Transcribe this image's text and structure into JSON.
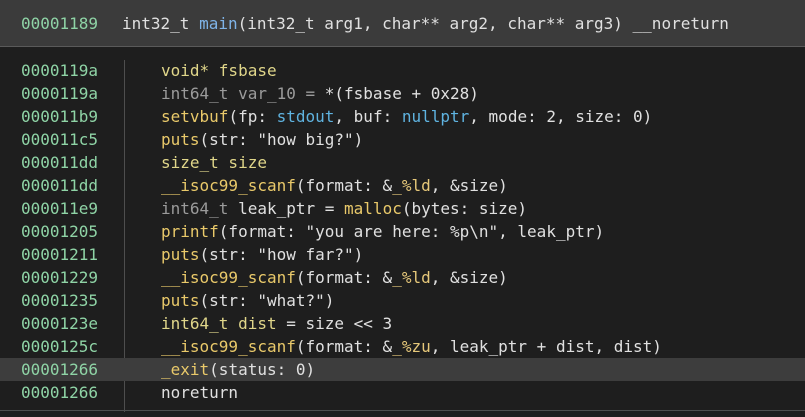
{
  "header": {
    "address": "00001189",
    "signature": [
      {
        "text": "int32_t ",
        "cls": "t-plain"
      },
      {
        "text": "main",
        "cls": "t-main"
      },
      {
        "text": "(int32_t arg1, char** arg2, char** arg3) __noreturn",
        "cls": "t-plain"
      }
    ]
  },
  "highlight_index": 13,
  "rows": [
    {
      "address": "0000119a",
      "tokens": [
        {
          "text": "void* fsbase",
          "cls": "t-type"
        }
      ]
    },
    {
      "address": "0000119a",
      "tokens": [
        {
          "text": "int64_t var_10 = ",
          "cls": "t-gray"
        },
        {
          "text": "*(fsbase + 0x28)",
          "cls": "t-plain"
        }
      ]
    },
    {
      "address": "000011b9",
      "tokens": [
        {
          "text": "setvbuf",
          "cls": "t-func"
        },
        {
          "text": "(fp: ",
          "cls": "t-plain"
        },
        {
          "text": "stdout",
          "cls": "t-kw"
        },
        {
          "text": ", buf: ",
          "cls": "t-plain"
        },
        {
          "text": "nullptr",
          "cls": "t-kw"
        },
        {
          "text": ", mode: 2, size: 0)",
          "cls": "t-plain"
        }
      ]
    },
    {
      "address": "000011c5",
      "tokens": [
        {
          "text": "puts",
          "cls": "t-func"
        },
        {
          "text": "(str: \"how big?\")",
          "cls": "t-plain"
        }
      ]
    },
    {
      "address": "000011dd",
      "tokens": [
        {
          "text": "size_t size",
          "cls": "t-type"
        }
      ]
    },
    {
      "address": "000011dd",
      "tokens": [
        {
          "text": "__isoc99_scanf",
          "cls": "t-func"
        },
        {
          "text": "(format: &",
          "cls": "t-plain"
        },
        {
          "text": "_%ld",
          "cls": "t-sym"
        },
        {
          "text": ", &size)",
          "cls": "t-plain"
        }
      ]
    },
    {
      "address": "000011e9",
      "tokens": [
        {
          "text": "int64_t ",
          "cls": "t-gray"
        },
        {
          "text": "leak_ptr = ",
          "cls": "t-plain"
        },
        {
          "text": "malloc",
          "cls": "t-func"
        },
        {
          "text": "(bytes: size)",
          "cls": "t-plain"
        }
      ]
    },
    {
      "address": "00001205",
      "tokens": [
        {
          "text": "printf",
          "cls": "t-func"
        },
        {
          "text": "(format: \"you are here: %p\\n\", leak_ptr)",
          "cls": "t-plain"
        }
      ]
    },
    {
      "address": "00001211",
      "tokens": [
        {
          "text": "puts",
          "cls": "t-func"
        },
        {
          "text": "(str: \"how far?\")",
          "cls": "t-plain"
        }
      ]
    },
    {
      "address": "00001229",
      "tokens": [
        {
          "text": "__isoc99_scanf",
          "cls": "t-func"
        },
        {
          "text": "(format: &",
          "cls": "t-plain"
        },
        {
          "text": "_%ld",
          "cls": "t-sym"
        },
        {
          "text": ", &size)",
          "cls": "t-plain"
        }
      ]
    },
    {
      "address": "00001235",
      "tokens": [
        {
          "text": "puts",
          "cls": "t-func"
        },
        {
          "text": "(str: \"what?\")",
          "cls": "t-plain"
        }
      ]
    },
    {
      "address": "0000123e",
      "tokens": [
        {
          "text": "int64_t dist",
          "cls": "t-type"
        },
        {
          "text": " = size << 3",
          "cls": "t-plain"
        }
      ]
    },
    {
      "address": "0000125c",
      "tokens": [
        {
          "text": "__isoc99_scanf",
          "cls": "t-func"
        },
        {
          "text": "(format: &",
          "cls": "t-plain"
        },
        {
          "text": "_%zu",
          "cls": "t-sym"
        },
        {
          "text": ", leak_ptr + dist, dist)",
          "cls": "t-plain"
        }
      ]
    },
    {
      "address": "00001266",
      "tokens": [
        {
          "text": "_exit",
          "cls": "t-func"
        },
        {
          "text": "(status: 0)",
          "cls": "t-plain"
        }
      ]
    },
    {
      "address": "00001266",
      "tokens": [
        {
          "text": "noreturn",
          "cls": "t-plain"
        }
      ]
    }
  ]
}
